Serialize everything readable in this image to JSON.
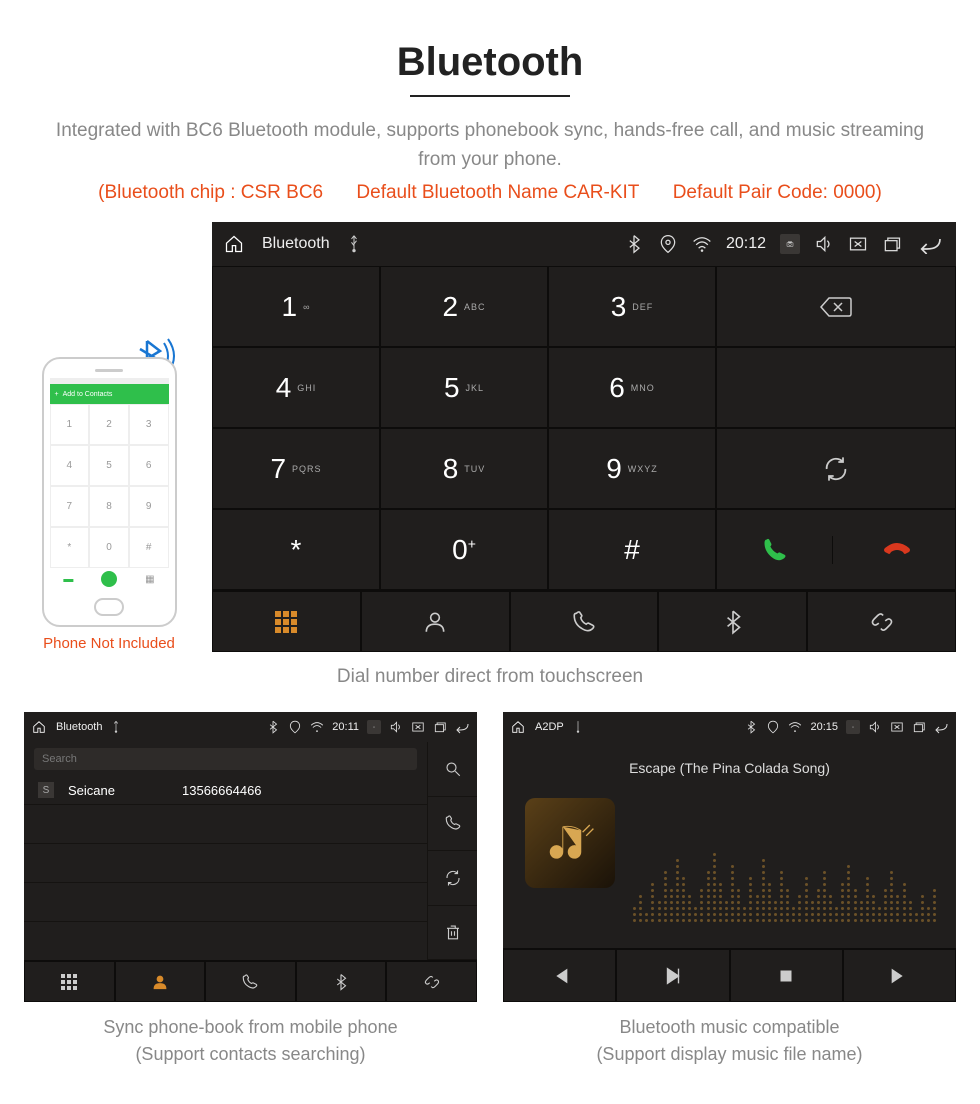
{
  "section": {
    "title": "Bluetooth",
    "description": "Integrated with BC6 Bluetooth module, supports phonebook sync, hands-free call, and music streaming from your phone.",
    "spec_chip": "(Bluetooth chip : CSR BC6",
    "spec_name": "Default Bluetooth Name CAR-KIT",
    "spec_code": "Default Pair Code: 0000)"
  },
  "phone": {
    "header": "Add to Contacts",
    "not_included": "Phone Not Included",
    "keys": [
      "1",
      "2",
      "3",
      "4",
      "5",
      "6",
      "7",
      "8",
      "9",
      "*",
      "0",
      "#"
    ]
  },
  "main": {
    "title": "Bluetooth",
    "time": "20:12",
    "keys": [
      {
        "num": "1",
        "sub": "∞"
      },
      {
        "num": "2",
        "sub": "ABC"
      },
      {
        "num": "3",
        "sub": "DEF"
      },
      {
        "num": "4",
        "sub": "GHI"
      },
      {
        "num": "5",
        "sub": "JKL"
      },
      {
        "num": "6",
        "sub": "MNO"
      },
      {
        "num": "7",
        "sub": "PQRS"
      },
      {
        "num": "8",
        "sub": "TUV"
      },
      {
        "num": "9",
        "sub": "WXYZ"
      },
      {
        "num": "*",
        "sub": ""
      },
      {
        "num": "0",
        "sub": "+",
        "sup": true
      },
      {
        "num": "#",
        "sub": ""
      }
    ],
    "caption": "Dial number direct from touchscreen"
  },
  "phonebook": {
    "title": "Bluetooth",
    "time": "20:11",
    "search_placeholder": "Search",
    "contact_badge": "S",
    "contact_name": "Seicane",
    "contact_number": "13566664466",
    "caption_l1": "Sync phone-book from mobile phone",
    "caption_l2": "(Support contacts searching)"
  },
  "music": {
    "title": "A2DP",
    "time": "20:15",
    "track": "Escape (The Pina Colada Song)",
    "caption_l1": "Bluetooth music compatible",
    "caption_l2": "(Support display music file name)"
  },
  "eq_heights": [
    3,
    5,
    2,
    7,
    4,
    9,
    6,
    11,
    8,
    5,
    3,
    6,
    9,
    12,
    7,
    4,
    10,
    6,
    3,
    8,
    5,
    11,
    7,
    4,
    9,
    6,
    3,
    5,
    8,
    4,
    6,
    9,
    5,
    3,
    7,
    10,
    6,
    4,
    8,
    5,
    3,
    6,
    9,
    5,
    7,
    4,
    2,
    5,
    3,
    6
  ]
}
